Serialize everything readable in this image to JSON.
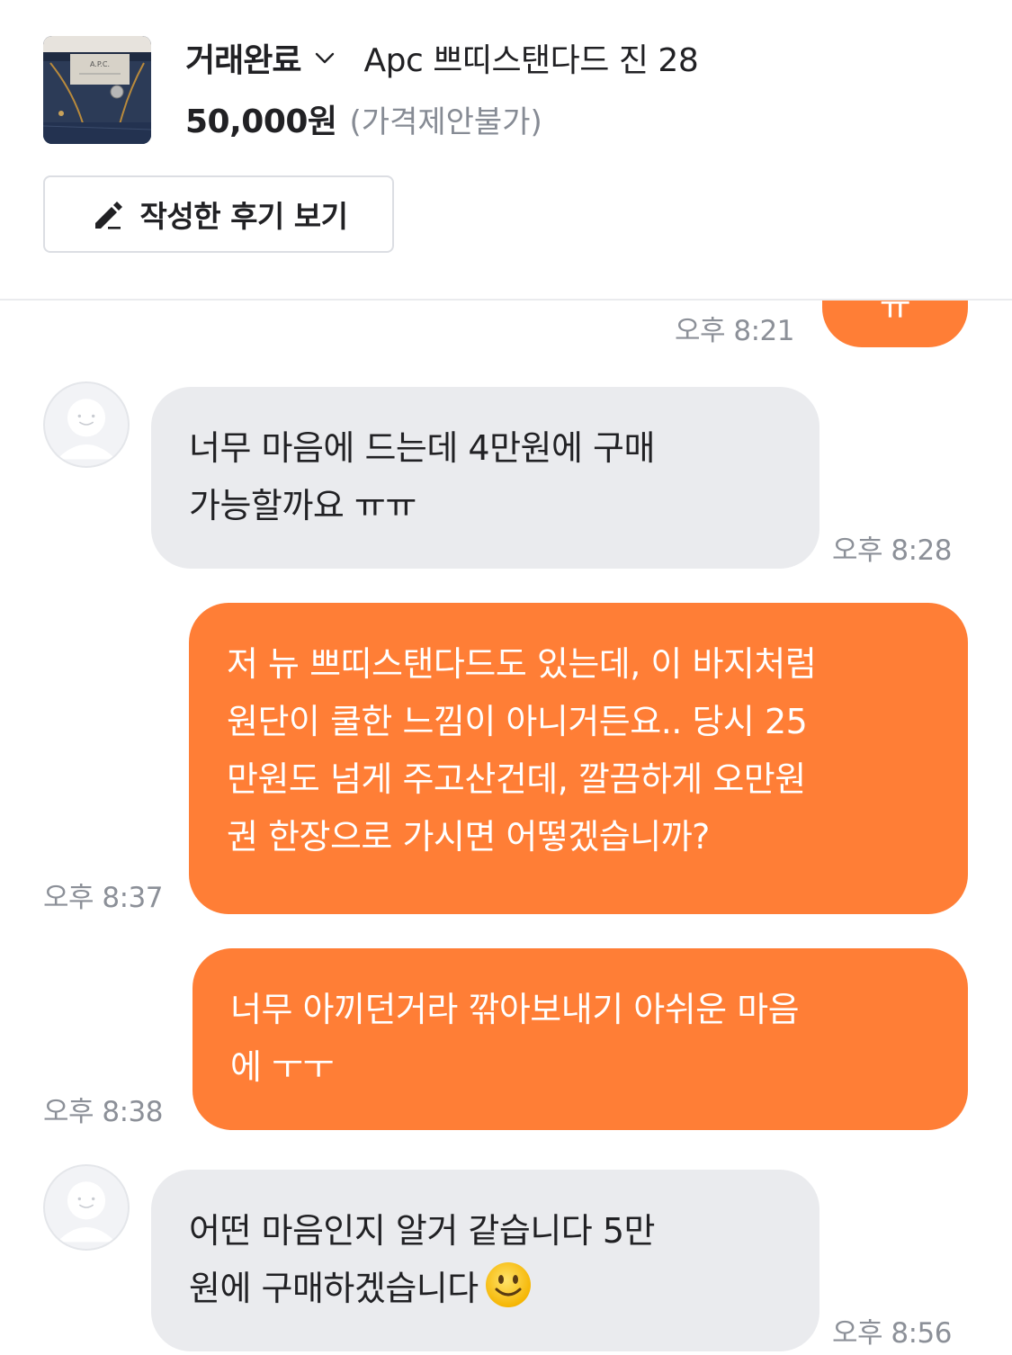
{
  "header": {
    "status": "거래완료",
    "product_title": "Apc 쁘띠스탠다드 진 28",
    "price": "50,000원",
    "price_note": "(가격제안불가)",
    "review_button": "작성한 후기 보기"
  },
  "messages": [
    {
      "from": "me",
      "partial": true,
      "time": "오후 8:21",
      "lines": [
        "ㅠ"
      ]
    },
    {
      "from": "them",
      "time": "오후 8:28",
      "lines": [
        "너무 마음에 드는데 4만원에 구매",
        "가능할까요 ㅠㅠ"
      ]
    },
    {
      "from": "me",
      "time": "오후 8:37",
      "lines": [
        "저 뉴 쁘띠스탠다드도 있는데, 이 바지처럼",
        "원단이 쿨한 느낌이 아니거든요.. 당시 25",
        "만원도 넘게 주고산건데, 깔끔하게 오만원",
        "권 한장으로 가시면 어떻겠습니까?"
      ]
    },
    {
      "from": "me",
      "time": "오후 8:38",
      "lines": [
        "너무 아끼던거라 깎아보내기 아쉬운 마음",
        "에 ㅜㅜ"
      ]
    },
    {
      "from": "them",
      "time": "오후 8:56",
      "lines": [
        "어떤 마음인지 알거 같습니다 5만",
        "원에 구매하겠습니다"
      ],
      "emoji": "smiling-face"
    }
  ],
  "colors": {
    "accent": "#ff7e36",
    "incoming_bubble": "#eaebee",
    "time_text": "#8c9098"
  }
}
